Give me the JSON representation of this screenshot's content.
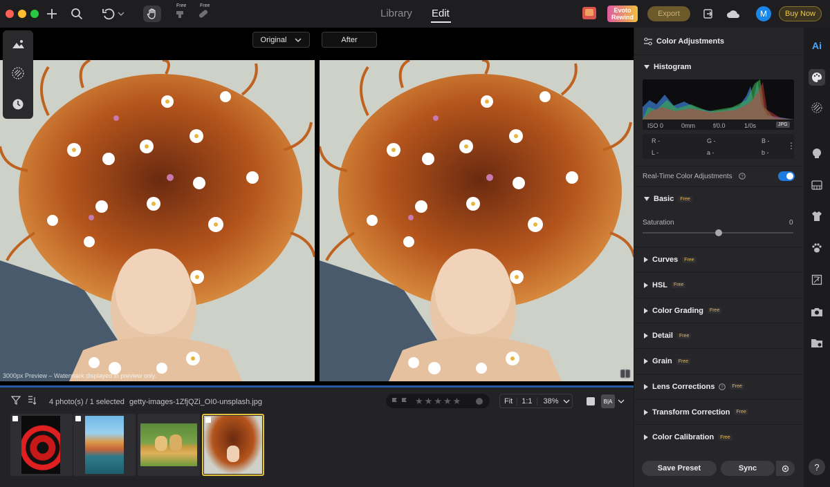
{
  "toolbar": {
    "free_tag_1": "Free",
    "free_tag_2": "Free",
    "tab_library": "Library",
    "tab_edit": "Edit",
    "evoto_rewind_line1": "Evoto",
    "evoto_rewind_line2": "Rewind",
    "export_label": "Export",
    "avatar_initial": "M",
    "buy_now_label": "Buy Now"
  },
  "canvas": {
    "original_select": "Original",
    "after_label": "After",
    "watermark_text": "3000px Preview – Watermark displayed in preview only."
  },
  "filmstrip": {
    "photo_count": "4 photo(s) / 1 selected",
    "filename": "getty-images-1ZfjQZi_OI0-unsplash.jpg",
    "zoom_fit": "Fit",
    "zoom_1to1": "1:1",
    "zoom_percent": "38%",
    "compare_label": "B|A",
    "rating_stars": 5
  },
  "panel": {
    "header_title": "Color Adjustments",
    "histogram_title": "Histogram",
    "iso": "ISO 0",
    "focal": "0mm",
    "aperture": "f/0.0",
    "shutter": "1/0s",
    "format": "JPG",
    "r_label": "R -",
    "g_label": "G -",
    "b_label": "B -",
    "l_label": "L -",
    "a_label": "a -",
    "bb_label": "b -",
    "realtime_label": "Real-Time Color Adjustments",
    "realtime_enabled": true,
    "basic_title": "Basic",
    "saturation_label": "Saturation",
    "saturation_value": "0",
    "free": "Free",
    "sections": [
      {
        "title": "Curves"
      },
      {
        "title": "HSL"
      },
      {
        "title": "Color Grading"
      },
      {
        "title": "Detail"
      },
      {
        "title": "Grain"
      },
      {
        "title": "Lens Corrections"
      },
      {
        "title": "Transform Correction"
      },
      {
        "title": "Color Calibration"
      }
    ],
    "save_preset": "Save Preset",
    "sync": "Sync"
  },
  "right_toolbar": {
    "ai_label": "Ai",
    "help_label": "?"
  },
  "colors": {
    "accent_blue": "#1f7ae0",
    "free_gold": "#e0b85a",
    "selection_yellow": "#e3c13a",
    "avatar_blue": "#1a87e8"
  }
}
